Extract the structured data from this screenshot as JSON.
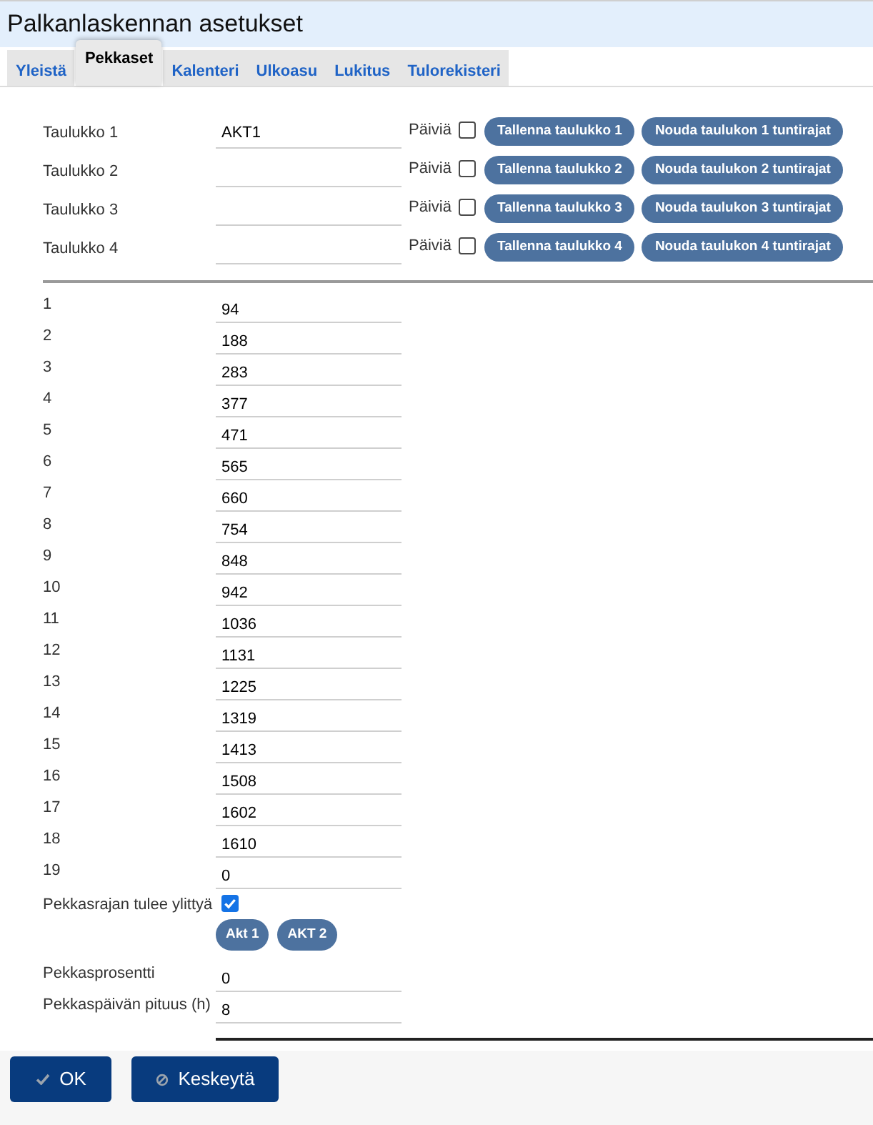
{
  "window": {
    "title": "Palkanlaskennan asetukset"
  },
  "tabs": [
    {
      "label": "Yleistä",
      "selected": false
    },
    {
      "label": "Pekkaset",
      "selected": true
    },
    {
      "label": "Kalenteri",
      "selected": false
    },
    {
      "label": "Ulkoasu",
      "selected": false
    },
    {
      "label": "Lukitus",
      "selected": false
    },
    {
      "label": "Tulorekisteri",
      "selected": false
    }
  ],
  "tables": [
    {
      "label": "Taulukko 1",
      "value": "AKT1",
      "days_label": "Päiviä",
      "days_checked": false,
      "save_button": "Tallenna taulukko 1",
      "load_button": "Nouda taulukon 1 tuntirajat"
    },
    {
      "label": "Taulukko 2",
      "days_label": "Päiviä",
      "days_checked": false,
      "save_button": "Tallenna taulukko 2",
      "load_button": "Nouda taulukon 2 tuntirajat"
    },
    {
      "label": "Taulukko 3",
      "days_label": "Päiviä",
      "days_checked": false,
      "save_button": "Tallenna taulukko 3",
      "load_button": "Nouda taulukon 3 tuntirajat"
    },
    {
      "label": "Taulukko 4",
      "days_label": "Päiviä",
      "days_checked": false,
      "save_button": "Tallenna taulukko 4",
      "load_button": "Nouda taulukon 4 tuntirajat"
    }
  ],
  "limits": [
    {
      "label": "1",
      "value": "94"
    },
    {
      "label": "2",
      "value": "188"
    },
    {
      "label": "3",
      "value": "283"
    },
    {
      "label": "4",
      "value": "377"
    },
    {
      "label": "5",
      "value": "471"
    },
    {
      "label": "6",
      "value": "565"
    },
    {
      "label": "7",
      "value": "660"
    },
    {
      "label": "8",
      "value": "754"
    },
    {
      "label": "9",
      "value": "848"
    },
    {
      "label": "10",
      "value": "942"
    },
    {
      "label": "11",
      "value": "1036"
    },
    {
      "label": "12",
      "value": "1131"
    },
    {
      "label": "13",
      "value": "1225"
    },
    {
      "label": "14",
      "value": "1319"
    },
    {
      "label": "15",
      "value": "1413"
    },
    {
      "label": "16",
      "value": "1508"
    },
    {
      "label": "17",
      "value": "1602"
    },
    {
      "label": "18",
      "value": "1610"
    },
    {
      "label": "19",
      "value": "0"
    }
  ],
  "exceed": {
    "label": "Pekkasrajan tulee ylittyä",
    "checked": true,
    "buttons": [
      "Akt 1",
      "AKT 2"
    ]
  },
  "fields": [
    {
      "label": "Pekkasprosentti",
      "value": "0"
    },
    {
      "label": "Pekkaspäivän pituus (h)",
      "value": "8"
    }
  ],
  "footer_buttons": [
    {
      "label": "OK",
      "kind": "ok"
    },
    {
      "label": "Keskeytä",
      "kind": "cancel"
    }
  ]
}
